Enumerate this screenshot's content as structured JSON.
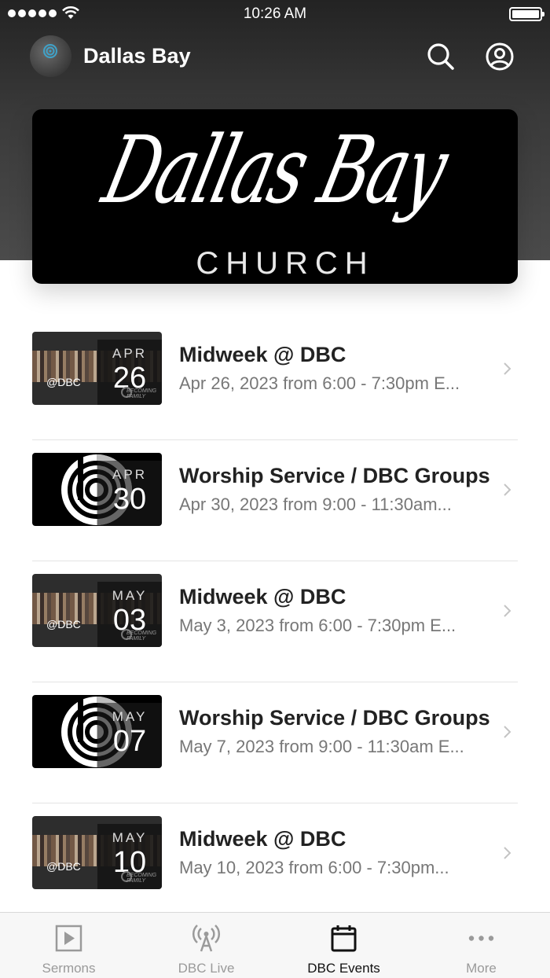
{
  "status_bar": {
    "time": "10:26 AM"
  },
  "app_bar": {
    "title": "Dallas Bay",
    "logo_text": "Dallas Bay",
    "search_icon": "search-icon",
    "account_icon": "account-icon"
  },
  "hero": {
    "script_text": "Dallas Bay",
    "subtitle": "CHURCH"
  },
  "events": [
    {
      "title": "Midweek @ DBC",
      "subtitle": "Apr 26, 2023 from 6:00 - 7:30pm E...",
      "month": "APR",
      "day": "26",
      "thumb": "midweek",
      "thumb_label": "@DBC",
      "thumb_tag": "BECOMING FAMILY"
    },
    {
      "title": "Worship Service / DBC Groups",
      "subtitle": "Apr 30, 2023 from 9:00 - 11:30am...",
      "month": "APR",
      "day": "30",
      "thumb": "worship"
    },
    {
      "title": "Midweek @ DBC",
      "subtitle": "May 3, 2023 from 6:00 - 7:30pm E...",
      "month": "MAY",
      "day": "03",
      "thumb": "midweek",
      "thumb_label": "@DBC",
      "thumb_tag": "BECOMING FAMILY"
    },
    {
      "title": "Worship Service / DBC Groups",
      "subtitle": "May 7, 2023 from 9:00 - 11:30am E...",
      "month": "MAY",
      "day": "07",
      "thumb": "worship"
    },
    {
      "title": "Midweek @ DBC",
      "subtitle": "May 10, 2023 from 6:00 - 7:30pm...",
      "month": "MAY",
      "day": "10",
      "thumb": "midweek",
      "thumb_label": "@DBC",
      "thumb_tag": "BECOMING FAMILY"
    }
  ],
  "tab_bar": {
    "tabs": [
      {
        "label": "Sermons",
        "icon": "play-icon",
        "active": false
      },
      {
        "label": "DBC Live",
        "icon": "broadcast-icon",
        "active": false
      },
      {
        "label": "DBC Events",
        "icon": "calendar-icon",
        "active": true
      },
      {
        "label": "More",
        "icon": "more-icon",
        "active": false
      }
    ]
  },
  "colors": {
    "header_dark": "#232323",
    "text_primary": "#222222",
    "text_secondary": "#777777",
    "tab_inactive": "#9a9a9a",
    "tab_active": "#111111"
  }
}
